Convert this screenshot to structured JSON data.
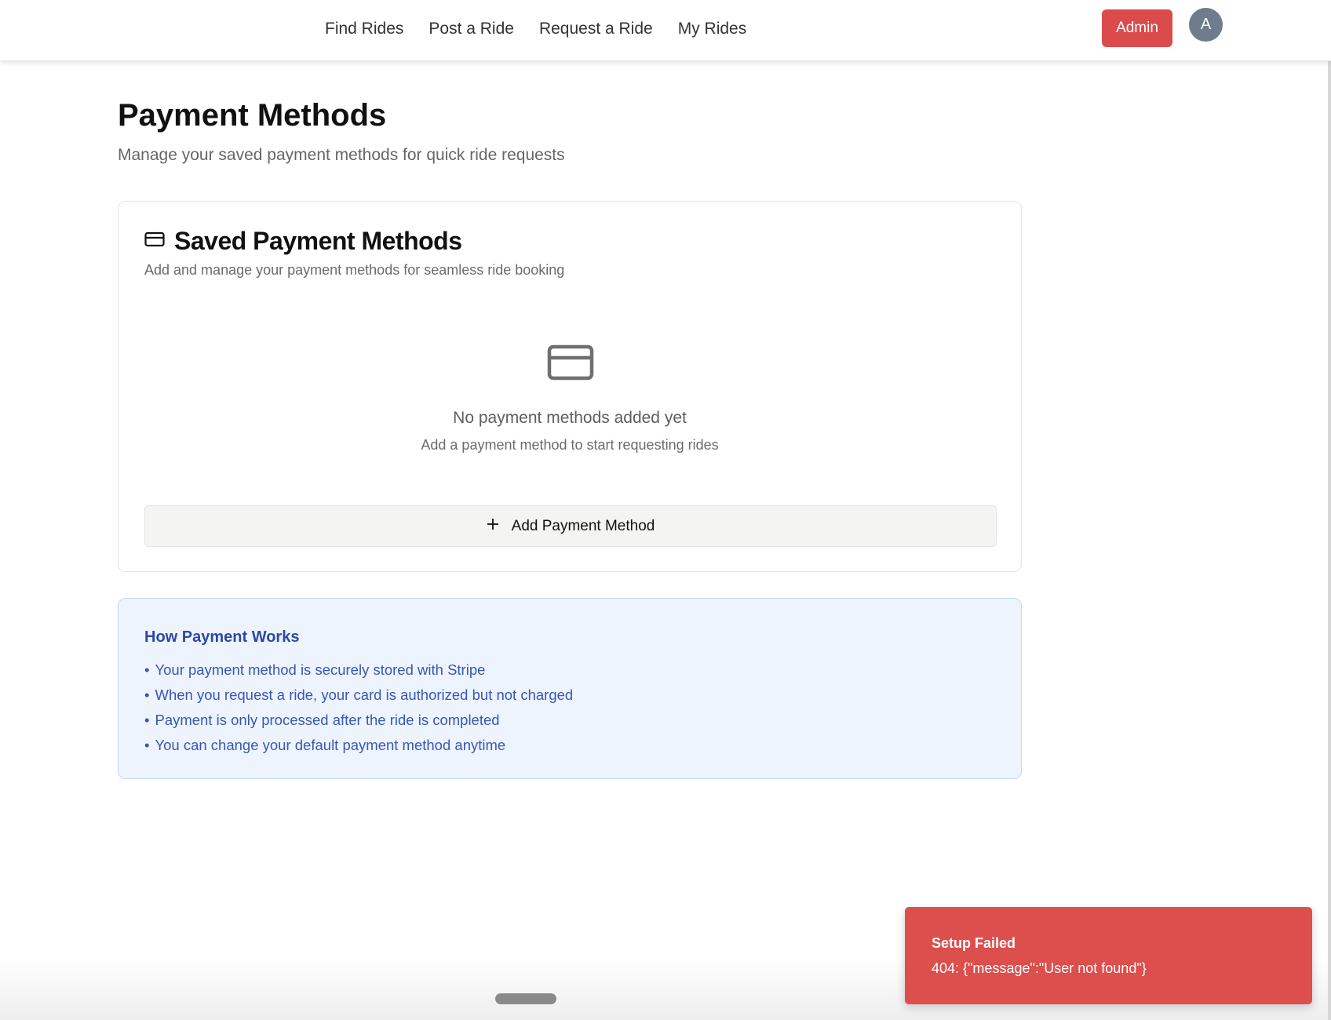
{
  "nav": {
    "items": [
      {
        "label": "Find Rides"
      },
      {
        "label": "Post a Ride"
      },
      {
        "label": "Request a Ride"
      },
      {
        "label": "My Rides"
      }
    ],
    "admin_label": "Admin",
    "avatar_initial": "A"
  },
  "page": {
    "title": "Payment Methods",
    "subtitle": "Manage your saved payment methods for quick ride requests"
  },
  "saved_card": {
    "icon": "credit-card-icon",
    "title": "Saved Payment Methods",
    "description": "Add and manage your payment methods for seamless ride booking",
    "empty_icon": "credit-card-icon",
    "empty_title": "No payment methods added yet",
    "empty_description": "Add a payment method to start requesting rides",
    "add_button_icon": "plus-icon",
    "add_button_label": "Add Payment Method"
  },
  "info": {
    "title": "How Payment Works",
    "items": [
      "Your payment method is securely stored with Stripe",
      "When you request a ride, your card is authorized but not charged",
      "Payment is only processed after the ride is completed",
      "You can change your default payment method anytime"
    ]
  },
  "toast": {
    "title": "Setup Failed",
    "message": "404: {\"message\":\"User not found\"}"
  },
  "colors": {
    "admin": "#dc4b4b",
    "toast": "#dc4f4d",
    "info_bg": "#eef4fd",
    "info_text": "#3856b8",
    "avatar": "#6f7c8b"
  }
}
